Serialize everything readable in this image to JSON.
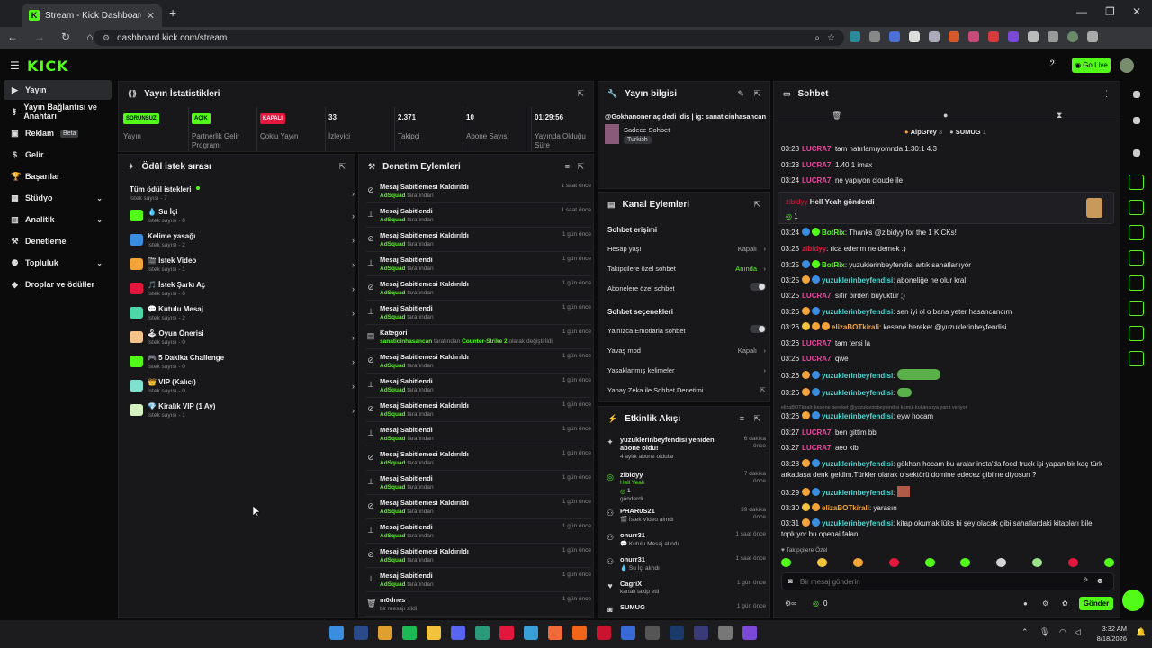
{
  "browser": {
    "tab_title": "Stream - Kick Dashboard",
    "url": "dashboard.kick.com/stream"
  },
  "header": {
    "logo": "KICK",
    "go_live": "Go Live"
  },
  "sidebar": {
    "items": [
      {
        "label": "Yayın",
        "icon": "broadcast-icon",
        "active": true
      },
      {
        "label": "Yayın Bağlantısı ve Anahtarı",
        "icon": "key-icon"
      },
      {
        "label": "Reklam",
        "icon": "ad-icon",
        "badge": "Beta"
      },
      {
        "label": "Gelir",
        "icon": "money-icon"
      },
      {
        "label": "Başarılar",
        "icon": "trophy-icon"
      },
      {
        "label": "Stüdyo",
        "icon": "studio-icon",
        "chevron": true
      },
      {
        "label": "Analitik",
        "icon": "chart-icon",
        "chevron": true
      },
      {
        "label": "Denetleme",
        "icon": "hammer-icon"
      },
      {
        "label": "Topluluk",
        "icon": "community-icon",
        "chevron": true
      },
      {
        "label": "Droplar ve ödüller",
        "icon": "drop-icon"
      }
    ]
  },
  "stats": {
    "title": "Yayın İstatistikleri",
    "items": [
      {
        "value": "SORUNSUZ",
        "label": "Yayın",
        "tag": true,
        "tag_color": "#53fc18",
        "text_color": "#000"
      },
      {
        "value": "AÇIK",
        "label": "Partnerlik Gelir Programı",
        "tag": true,
        "tag_color": "#53fc18",
        "text_color": "#000"
      },
      {
        "value": "KAPALI",
        "label": "Çoklu Yayın",
        "tag": true,
        "tag_color": "#e3173e",
        "text_color": "#fff"
      },
      {
        "value": "33",
        "label": "İzleyici"
      },
      {
        "value": "2.371",
        "label": "Takipçi"
      },
      {
        "value": "10",
        "label": "Abone Sayısı"
      },
      {
        "value": "01:29:56",
        "label": "Yayında Olduğu Süre"
      }
    ]
  },
  "rewards": {
    "title": "Ödül istek sırası",
    "all": "Tüm ödül istekleri",
    "all_sub": "İstek sayısı - 7",
    "items": [
      {
        "name": "💧 Su İçi",
        "sub": "İstek sayısı - 0",
        "color": "#53fc18"
      },
      {
        "name": "Kelime yasağı",
        "sub": "İstek sayısı - 2",
        "color": "#3a8ddf"
      },
      {
        "name": "🎬 İstek Video",
        "sub": "İstek sayısı - 1",
        "color": "#f2a33a"
      },
      {
        "name": "🎵 İstek Şarkı Aç",
        "sub": "İstek sayısı - 0",
        "color": "#e3173e"
      },
      {
        "name": "💬 Kutulu Mesaj",
        "sub": "İstek sayısı - 2",
        "color": "#4fd6a8"
      },
      {
        "name": "🕹 Oyun Önerisi",
        "sub": "İstek sayısı - 0",
        "color": "#f4c38a"
      },
      {
        "name": "🎮 5 Dakika Challenge",
        "sub": "İstek sayısı - 0",
        "color": "#53fc18"
      },
      {
        "name": "👑 VIP (Kalıcı)",
        "sub": "İstek sayısı - 0",
        "color": "#7fe0d0"
      },
      {
        "name": "💎 Kiralık VIP (1 Ay)",
        "sub": "İstek sayısı - 1",
        "color": "#d4f2c0"
      }
    ]
  },
  "moderation": {
    "title": "Denetim Eylemleri",
    "items": [
      {
        "title": "Mesaj Sabitlemesi Kaldırıldı",
        "by": "AdSquad",
        "suffix": "tarafından",
        "time": "1 saat önce",
        "icon": "unpin-icon"
      },
      {
        "title": "Mesaj Sabitlendi",
        "by": "AdSquad",
        "suffix": "tarafından",
        "time": "1 saat önce",
        "icon": "pin-icon"
      },
      {
        "title": "Mesaj Sabitlemesi Kaldırıldı",
        "by": "AdSquad",
        "suffix": "tarafından",
        "time": "1 gün önce",
        "icon": "unpin-icon"
      },
      {
        "title": "Mesaj Sabitlendi",
        "by": "AdSquad",
        "suffix": "tarafından",
        "time": "1 gün önce",
        "icon": "pin-icon"
      },
      {
        "title": "Mesaj Sabitlemesi Kaldırıldı",
        "by": "AdSquad",
        "suffix": "tarafından",
        "time": "1 gün önce",
        "icon": "unpin-icon"
      },
      {
        "title": "Mesaj Sabitlendi",
        "by": "AdSquad",
        "suffix": "tarafından",
        "time": "1 gün önce",
        "icon": "pin-icon"
      },
      {
        "title": "Kategori",
        "by": "sanaticinhasancan",
        "suffix": "tarafından",
        "extra": "Counter-Strike 2",
        "extra_suffix": "olarak değiştirildi",
        "time": "1 gün önce",
        "icon": "category-icon"
      },
      {
        "title": "Mesaj Sabitlemesi Kaldırıldı",
        "by": "AdSquad",
        "suffix": "tarafından",
        "time": "1 gün önce",
        "icon": "unpin-icon"
      },
      {
        "title": "Mesaj Sabitlendi",
        "by": "AdSquad",
        "suffix": "tarafından",
        "time": "1 gün önce",
        "icon": "pin-icon"
      },
      {
        "title": "Mesaj Sabitlemesi Kaldırıldı",
        "by": "AdSquad",
        "suffix": "tarafından",
        "time": "1 gün önce",
        "icon": "unpin-icon"
      },
      {
        "title": "Mesaj Sabitlendi",
        "by": "AdSquad",
        "suffix": "tarafından",
        "time": "1 gün önce",
        "icon": "pin-icon"
      },
      {
        "title": "Mesaj Sabitlemesi Kaldırıldı",
        "by": "AdSquad",
        "suffix": "tarafından",
        "time": "1 gün önce",
        "icon": "unpin-icon"
      },
      {
        "title": "Mesaj Sabitlendi",
        "by": "AdSquad",
        "suffix": "tarafından",
        "time": "1 gün önce",
        "icon": "pin-icon"
      },
      {
        "title": "Mesaj Sabitlemesi Kaldırıldı",
        "by": "AdSquad",
        "suffix": "tarafından",
        "time": "1 gün önce",
        "icon": "unpin-icon"
      },
      {
        "title": "Mesaj Sabitlendi",
        "by": "AdSquad",
        "suffix": "tarafından",
        "time": "1 gün önce",
        "icon": "pin-icon"
      },
      {
        "title": "Mesaj Sabitlemesi Kaldırıldı",
        "by": "AdSquad",
        "suffix": "tarafından",
        "time": "1 gün önce",
        "icon": "unpin-icon"
      },
      {
        "title": "Mesaj Sabitlendi",
        "by": "AdSquad",
        "suffix": "tarafından",
        "time": "1 gün önce",
        "icon": "pin-icon"
      },
      {
        "title": "m0dnes",
        "by": "",
        "suffix": "bir mesajı sildi",
        "time": "1 gün önce",
        "icon": "trash-icon"
      }
    ]
  },
  "stream_info": {
    "title": "Yayın bilgisi",
    "stream_title": "@Gokhanoner aç dedi İdiş | ig: sanaticinhasancan",
    "category": "Sadece Sohbet",
    "tag": "Turkish"
  },
  "channel_actions": {
    "title": "Kanal Eylemleri",
    "chat_access": "Sohbet erişimi",
    "age": "Hesap yaşı",
    "age_val": "Kapalı",
    "followers": "Takipçilere özel sohbet",
    "followers_val": "Anında",
    "subs": "Abonelere özel sohbet",
    "chat_options": "Sohbet seçenekleri",
    "emotes": "Yalnızca Emotlarla sohbet",
    "slow": "Yavaş mod",
    "slow_val": "Kapalı",
    "banned": "Yasaklanmış kelimeler",
    "ai": "Yapay Zeka ile Sohbet Denetimi"
  },
  "activity": {
    "title": "Etkinlik Akışı",
    "items": [
      {
        "title": "yuzuklerinbeyfendisi yeniden abone oldu!",
        "sub": "4 aylık abone oldular",
        "time": "6 dakika önce",
        "icon": "star-icon"
      },
      {
        "title": "zibidyy",
        "sub": "Hell Yeah",
        "sub2": "1",
        "sub3": "gönderdi",
        "time": "7 dakika önce",
        "icon": "kick-coin-icon"
      },
      {
        "title": "PHAR0S21",
        "sub": "🎬 İstek Video alındı",
        "time": "39 dakika önce",
        "icon": "gift-icon"
      },
      {
        "title": "onurr31",
        "sub": "💬 Kutulu Mesaj alındı",
        "time": "1 saat önce",
        "icon": "gift-icon"
      },
      {
        "title": "onurr31",
        "sub": "💧 Su İçi alındı",
        "time": "1 saat önce",
        "icon": "gift-icon"
      },
      {
        "title": "CagriX",
        "sub": "kanalı takip etti",
        "time": "1 gün önce",
        "icon": "heart-icon"
      },
      {
        "title": "SUMUG",
        "sub": "",
        "time": "1 gün önce",
        "icon": "kick-icon"
      }
    ]
  },
  "chat": {
    "title": "Sohbet",
    "top": [
      {
        "name": "AlpGrey",
        "count": "3"
      },
      {
        "name": "SUMUG",
        "count": "1"
      }
    ],
    "highlight": {
      "user": "zibidyy",
      "text": "Hell Yeah gönderdi",
      "amount": "1"
    },
    "messages": [
      {
        "time": "03:23",
        "user": "LUCRA7",
        "color": "#e34b9d",
        "text": "tam hatırlamıyomnda 1.30:1 4.3"
      },
      {
        "time": "03:23",
        "user": "LUCRA7",
        "color": "#e34b9d",
        "text": "1.40:1 imax"
      },
      {
        "time": "03:24",
        "user": "LUCRA7",
        "color": "#e34b9d",
        "text": "ne yapıyon cloude ile"
      },
      {
        "time": "03:24",
        "user": "BotRix",
        "color": "#53fc18",
        "text": "Thanks @zibidyy for the 1 KICKs!",
        "badges": [
          "#3a8ddf",
          "#53fc18"
        ]
      },
      {
        "time": "03:25",
        "user": "zibidyy",
        "color": "#e3173e",
        "text": "rica ederim ne demek :)"
      },
      {
        "time": "03:25",
        "user": "BotRix",
        "color": "#53fc18",
        "text": "yuzuklerinbeyfendisi artık sanatlanıyor",
        "badges": [
          "#3a8ddf",
          "#53fc18"
        ]
      },
      {
        "time": "03:25",
        "user": "yuzuklerinbeyfendisi",
        "color": "#4fd6d0",
        "text": "aboneliğe ne olur kral",
        "badges": [
          "#f2a33a",
          "#3a8ddf"
        ]
      },
      {
        "time": "03:25",
        "user": "LUCRA7",
        "color": "#e34b9d",
        "text": "sıfır birden büyüktür ;)"
      },
      {
        "time": "03:26",
        "user": "yuzuklerinbeyfendisi",
        "color": "#4fd6d0",
        "text": "sen iyi ol o bana yeter hasancancım",
        "badges": [
          "#f2a33a",
          "#3a8ddf"
        ]
      },
      {
        "time": "03:26",
        "user": "elizaBOTkirali",
        "color": "#f2a33a",
        "text": "kesene bereket @yuzuklerinbeyfendisi",
        "badges": [
          "#f2c33a",
          "#f2a33a",
          "#f2a33a"
        ]
      },
      {
        "time": "03:26",
        "user": "LUCRA7",
        "color": "#e34b9d",
        "text": "tam tersi la"
      },
      {
        "time": "03:26",
        "user": "LUCRA7",
        "color": "#e34b9d",
        "text": "qwe"
      },
      {
        "time": "03:26",
        "user": "yuzuklerinbeyfendisi",
        "color": "#4fd6d0",
        "text": "",
        "badges": [
          "#f2a33a",
          "#3a8ddf"
        ],
        "emote": true
      },
      {
        "time": "03:26",
        "user": "yuzuklerinbeyfendisi",
        "color": "#4fd6d0",
        "text": "",
        "badges": [
          "#f2a33a",
          "#3a8ddf"
        ],
        "emote_small": true
      },
      {
        "time": "03:26",
        "user": "yuzuklerinbeyfendisi",
        "color": "#4fd6d0",
        "text": "eyw hocam",
        "badges": [
          "#f2a33a",
          "#3a8ddf"
        ],
        "reply": "elizaBOTkirali: kesene bereket @yuzuklerinbeyfendisi kümül kullanıcıya yanıt veriyor"
      },
      {
        "time": "03:27",
        "user": "LUCRA7",
        "color": "#e34b9d",
        "text": "ben gittim bb"
      },
      {
        "time": "03:27",
        "user": "LUCRA7",
        "color": "#e34b9d",
        "text": "aeo kib"
      },
      {
        "time": "03:28",
        "user": "yuzuklerinbeyfendisi",
        "color": "#4fd6d0",
        "text": "gökhan hocam bu aralar insta'da food truck işi yapan bir kaç türk arkadaşa denk geldim.Türkler olarak o sektörü domine edecez gibi ne diyosun ?",
        "badges": [
          "#f2a33a",
          "#3a8ddf"
        ]
      },
      {
        "time": "03:29",
        "user": "yuzuklerinbeyfendisi",
        "color": "#4fd6d0",
        "text": "",
        "badges": [
          "#f2a33a",
          "#3a8ddf"
        ],
        "emote_img": true
      },
      {
        "time": "03:30",
        "user": "elizaBOTkirali",
        "color": "#f2a33a",
        "text": "yarasın",
        "badges": [
          "#f2c33a",
          "#f2a33a"
        ]
      },
      {
        "time": "03:31",
        "user": "yuzuklerinbeyfendisi",
        "color": "#4fd6d0",
        "text": "kitap okumak lüks bi şey olacak gibi sahaflardaki kitapları bile topluyor bu openai falan",
        "badges": [
          "#f2a33a",
          "#3a8ddf"
        ]
      }
    ],
    "followers_only": "Takipçilere Özel",
    "placeholder": "Bir mesaj gönderin",
    "send": "Gönder",
    "count": "0"
  },
  "taskbar": {
    "time": "3:32 AM",
    "date": "8/18/2026"
  }
}
